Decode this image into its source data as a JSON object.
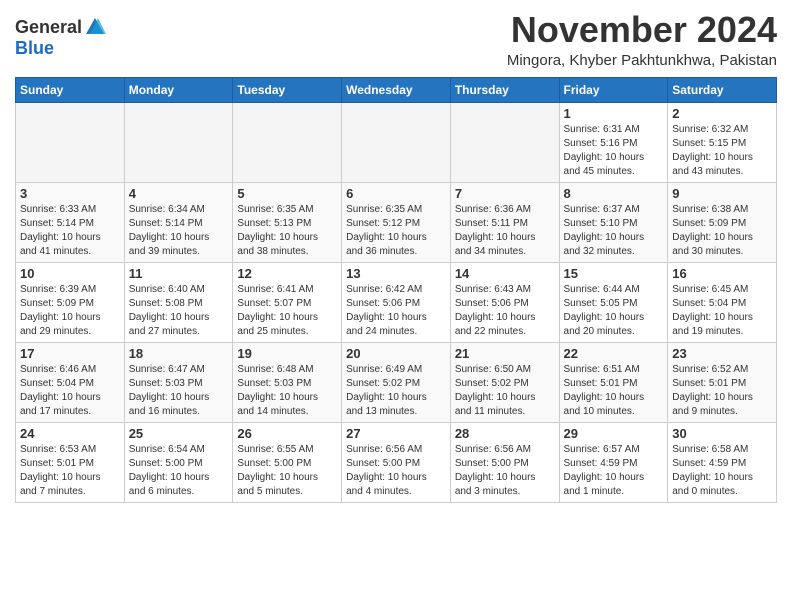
{
  "header": {
    "logo_general": "General",
    "logo_blue": "Blue",
    "month_title": "November 2024",
    "location": "Mingora, Khyber Pakhtunkhwa, Pakistan"
  },
  "weekdays": [
    "Sunday",
    "Monday",
    "Tuesday",
    "Wednesday",
    "Thursday",
    "Friday",
    "Saturday"
  ],
  "weeks": [
    [
      {
        "day": "",
        "info": ""
      },
      {
        "day": "",
        "info": ""
      },
      {
        "day": "",
        "info": ""
      },
      {
        "day": "",
        "info": ""
      },
      {
        "day": "",
        "info": ""
      },
      {
        "day": "1",
        "info": "Sunrise: 6:31 AM\nSunset: 5:16 PM\nDaylight: 10 hours\nand 45 minutes."
      },
      {
        "day": "2",
        "info": "Sunrise: 6:32 AM\nSunset: 5:15 PM\nDaylight: 10 hours\nand 43 minutes."
      }
    ],
    [
      {
        "day": "3",
        "info": "Sunrise: 6:33 AM\nSunset: 5:14 PM\nDaylight: 10 hours\nand 41 minutes."
      },
      {
        "day": "4",
        "info": "Sunrise: 6:34 AM\nSunset: 5:14 PM\nDaylight: 10 hours\nand 39 minutes."
      },
      {
        "day": "5",
        "info": "Sunrise: 6:35 AM\nSunset: 5:13 PM\nDaylight: 10 hours\nand 38 minutes."
      },
      {
        "day": "6",
        "info": "Sunrise: 6:35 AM\nSunset: 5:12 PM\nDaylight: 10 hours\nand 36 minutes."
      },
      {
        "day": "7",
        "info": "Sunrise: 6:36 AM\nSunset: 5:11 PM\nDaylight: 10 hours\nand 34 minutes."
      },
      {
        "day": "8",
        "info": "Sunrise: 6:37 AM\nSunset: 5:10 PM\nDaylight: 10 hours\nand 32 minutes."
      },
      {
        "day": "9",
        "info": "Sunrise: 6:38 AM\nSunset: 5:09 PM\nDaylight: 10 hours\nand 30 minutes."
      }
    ],
    [
      {
        "day": "10",
        "info": "Sunrise: 6:39 AM\nSunset: 5:09 PM\nDaylight: 10 hours\nand 29 minutes."
      },
      {
        "day": "11",
        "info": "Sunrise: 6:40 AM\nSunset: 5:08 PM\nDaylight: 10 hours\nand 27 minutes."
      },
      {
        "day": "12",
        "info": "Sunrise: 6:41 AM\nSunset: 5:07 PM\nDaylight: 10 hours\nand 25 minutes."
      },
      {
        "day": "13",
        "info": "Sunrise: 6:42 AM\nSunset: 5:06 PM\nDaylight: 10 hours\nand 24 minutes."
      },
      {
        "day": "14",
        "info": "Sunrise: 6:43 AM\nSunset: 5:06 PM\nDaylight: 10 hours\nand 22 minutes."
      },
      {
        "day": "15",
        "info": "Sunrise: 6:44 AM\nSunset: 5:05 PM\nDaylight: 10 hours\nand 20 minutes."
      },
      {
        "day": "16",
        "info": "Sunrise: 6:45 AM\nSunset: 5:04 PM\nDaylight: 10 hours\nand 19 minutes."
      }
    ],
    [
      {
        "day": "17",
        "info": "Sunrise: 6:46 AM\nSunset: 5:04 PM\nDaylight: 10 hours\nand 17 minutes."
      },
      {
        "day": "18",
        "info": "Sunrise: 6:47 AM\nSunset: 5:03 PM\nDaylight: 10 hours\nand 16 minutes."
      },
      {
        "day": "19",
        "info": "Sunrise: 6:48 AM\nSunset: 5:03 PM\nDaylight: 10 hours\nand 14 minutes."
      },
      {
        "day": "20",
        "info": "Sunrise: 6:49 AM\nSunset: 5:02 PM\nDaylight: 10 hours\nand 13 minutes."
      },
      {
        "day": "21",
        "info": "Sunrise: 6:50 AM\nSunset: 5:02 PM\nDaylight: 10 hours\nand 11 minutes."
      },
      {
        "day": "22",
        "info": "Sunrise: 6:51 AM\nSunset: 5:01 PM\nDaylight: 10 hours\nand 10 minutes."
      },
      {
        "day": "23",
        "info": "Sunrise: 6:52 AM\nSunset: 5:01 PM\nDaylight: 10 hours\nand 9 minutes."
      }
    ],
    [
      {
        "day": "24",
        "info": "Sunrise: 6:53 AM\nSunset: 5:01 PM\nDaylight: 10 hours\nand 7 minutes."
      },
      {
        "day": "25",
        "info": "Sunrise: 6:54 AM\nSunset: 5:00 PM\nDaylight: 10 hours\nand 6 minutes."
      },
      {
        "day": "26",
        "info": "Sunrise: 6:55 AM\nSunset: 5:00 PM\nDaylight: 10 hours\nand 5 minutes."
      },
      {
        "day": "27",
        "info": "Sunrise: 6:56 AM\nSunset: 5:00 PM\nDaylight: 10 hours\nand 4 minutes."
      },
      {
        "day": "28",
        "info": "Sunrise: 6:56 AM\nSunset: 5:00 PM\nDaylight: 10 hours\nand 3 minutes."
      },
      {
        "day": "29",
        "info": "Sunrise: 6:57 AM\nSunset: 4:59 PM\nDaylight: 10 hours\nand 1 minute."
      },
      {
        "day": "30",
        "info": "Sunrise: 6:58 AM\nSunset: 4:59 PM\nDaylight: 10 hours\nand 0 minutes."
      }
    ]
  ]
}
